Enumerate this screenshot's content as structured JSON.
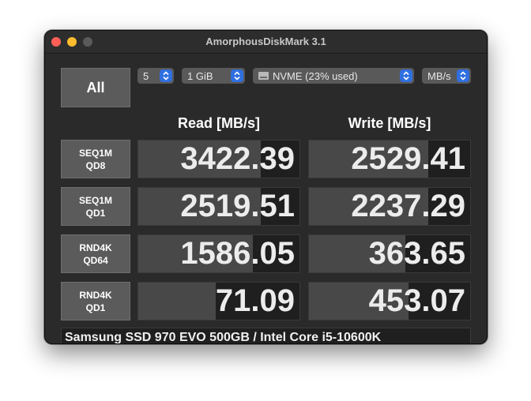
{
  "window": {
    "title": "AmorphousDiskMark 3.1"
  },
  "controls": {
    "all_label": "All",
    "count": "5",
    "size": "1 GiB",
    "drive": "NVME (23% used)",
    "unit": "MB/s"
  },
  "headers": {
    "read": "Read [MB/s]",
    "write": "Write [MB/s]"
  },
  "rows": [
    {
      "label1": "SEQ1M",
      "label2": "QD8",
      "read": "3422.39",
      "write": "2529.41",
      "read_fill": 0.76,
      "write_fill": 0.74
    },
    {
      "label1": "SEQ1M",
      "label2": "QD1",
      "read": "2519.51",
      "write": "2237.29",
      "read_fill": 0.76,
      "write_fill": 0.74
    },
    {
      "label1": "RND4K",
      "label2": "QD64",
      "read": "1586.05",
      "write": "363.65",
      "read_fill": 0.71,
      "write_fill": 0.6
    },
    {
      "label1": "RND4K",
      "label2": "QD1",
      "read": "71.09",
      "write": "453.07",
      "read_fill": 0.48,
      "write_fill": 0.62
    }
  ],
  "footer": "Samsung SSD 970 EVO 500GB / Intel Core i5-10600K",
  "icons": {
    "close": "close-icon",
    "minimize": "minimize-icon",
    "zoom": "zoom-icon",
    "chevron": "updown-chevron-icon",
    "drive": "drive-icon"
  },
  "colors": {
    "accent": "#2f6fe0",
    "close": "#ff5f57",
    "minimize": "#febc2e"
  }
}
